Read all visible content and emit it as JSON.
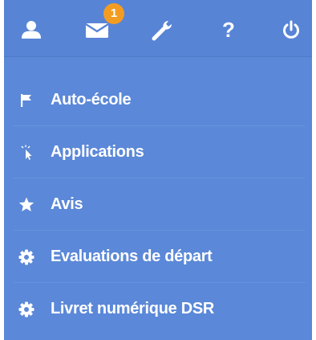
{
  "topbar": {
    "icons": [
      "user-icon",
      "mail-icon",
      "wrench-icon",
      "help-icon",
      "power-icon"
    ],
    "mail_badge": "1",
    "help_glyph": "?"
  },
  "menu": {
    "items": [
      {
        "label": "Auto-école",
        "icon": "flag-icon"
      },
      {
        "label": "Applications",
        "icon": "pointer-icon"
      },
      {
        "label": "Avis",
        "icon": "star-icon"
      },
      {
        "label": "Evaluations de départ",
        "icon": "gear-icon"
      },
      {
        "label": "Livret numérique DSR",
        "icon": "gear-icon"
      }
    ]
  },
  "colors": {
    "panel": "#5b88d8",
    "badge": "#f39c22",
    "text": "#ffffff"
  }
}
